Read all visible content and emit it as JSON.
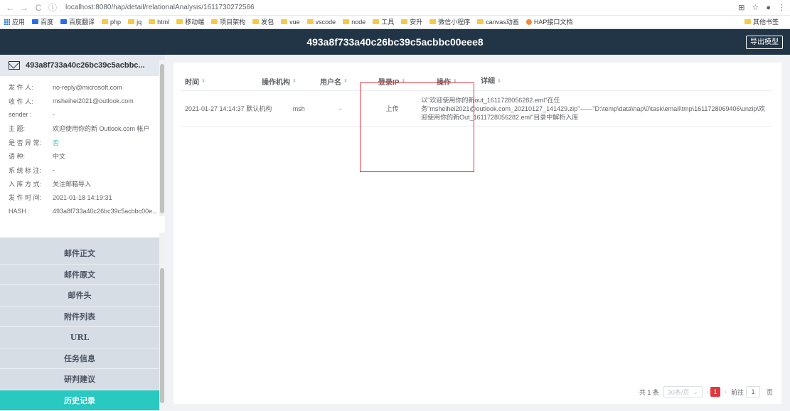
{
  "browser": {
    "url": "localhost:8080/hap/detail/relationalAnalysis/1611730272566",
    "bookmarks": [
      {
        "label": "应用"
      },
      {
        "label": "百度"
      },
      {
        "label": "百度翻译"
      },
      {
        "label": "php"
      },
      {
        "label": "jq"
      },
      {
        "label": "html"
      },
      {
        "label": "移动端"
      },
      {
        "label": "项目架构"
      },
      {
        "label": "发包"
      },
      {
        "label": "vue"
      },
      {
        "label": "vscode"
      },
      {
        "label": "node"
      },
      {
        "label": "工具"
      },
      {
        "label": "安升"
      },
      {
        "label": "微信小程序"
      },
      {
        "label": "canvas动画"
      },
      {
        "label": "HAP接口文档"
      }
    ],
    "other_bookmarks": "其他书签"
  },
  "header": {
    "title": "493a8f733a40c26bc39c5acbbc00eee8",
    "export_label": "导出模型"
  },
  "sidebar": {
    "title": "493a8f733a40c26bc39c5acbbc...",
    "fields": [
      {
        "label": "发 件 人:",
        "value": "no-reply@microsoft.com"
      },
      {
        "label": "收 件 人:",
        "value": "msheihei2021@outlook.com"
      },
      {
        "label": "sender :",
        "value": "-"
      },
      {
        "label": "主     题:",
        "value": "欢迎使用你的新 Outlook.com 帐户"
      },
      {
        "label": "是 否 异 常:",
        "value": "否"
      },
      {
        "label": "语     种:",
        "value": "中文"
      },
      {
        "label": "系 统 标 注:",
        "value": "-"
      },
      {
        "label": "入 库 方 式:",
        "value": "关注邮箱导入"
      },
      {
        "label": "发 件 时 间:",
        "value": "2021-01-18 14:19:31"
      },
      {
        "label": "HASH :",
        "value": "493a8f733a40c26bc39c5acbbc00e..."
      }
    ],
    "menu": [
      {
        "label": "邮件正文"
      },
      {
        "label": "邮件原文"
      },
      {
        "label": "邮件头"
      },
      {
        "label": "附件列表"
      },
      {
        "label": "URL"
      },
      {
        "label": "任务信息"
      },
      {
        "label": "研判建议"
      },
      {
        "label": "历史记录"
      }
    ]
  },
  "table": {
    "columns": [
      {
        "label": "时间"
      },
      {
        "label": "操作机构"
      },
      {
        "label": "用户名"
      },
      {
        "label": "登录IP"
      },
      {
        "label": "操作"
      },
      {
        "label": "详细"
      }
    ],
    "rows": [
      {
        "time": "2021-01-27 14:14:37",
        "org": "默认机构",
        "user": "msh",
        "ip": "-",
        "action": "上传",
        "detail": "以\"欢迎使用你的新out_1611728056282.eml\"在任务\"msheihei2021@outlook.com_20210127_141429.zip\"——\"D:\\temp\\data\\hap\\0\\task\\email\\tmp\\1611728069406\\unzip\\欢迎使用你的新Out_1611728056282.eml\"目录中解析入库"
      }
    ]
  },
  "pagination": {
    "total": "共 1 条",
    "page_size": "30条/页",
    "current": "1",
    "goto_label": "前往",
    "goto_value": "1",
    "page_suffix": "页"
  },
  "colors": {
    "header": "#213547",
    "active_menu": "#27c9c0",
    "highlight_box": "#e0383e"
  }
}
